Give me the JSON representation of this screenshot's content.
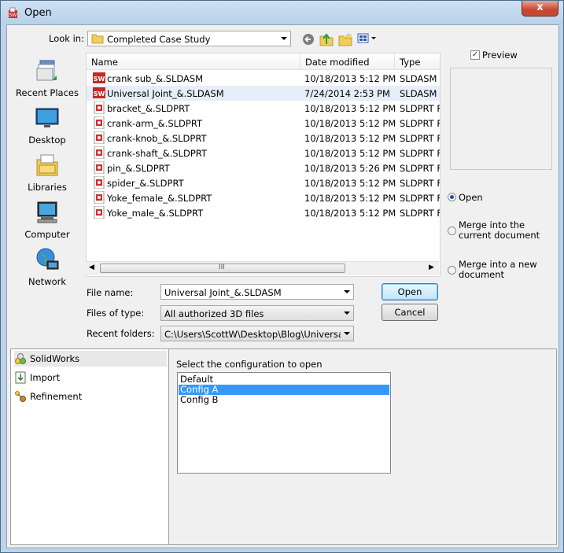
{
  "window": {
    "title": "Open",
    "close_label": "x"
  },
  "toolbar": {
    "look_in_label": "Look in:",
    "look_in_value": "Completed Case Study"
  },
  "places": [
    {
      "label": "Recent Places",
      "icon": "recent-places-icon"
    },
    {
      "label": "Desktop",
      "icon": "desktop-icon"
    },
    {
      "label": "Libraries",
      "icon": "libraries-icon"
    },
    {
      "label": "Computer",
      "icon": "computer-icon"
    },
    {
      "label": "Network",
      "icon": "network-icon"
    }
  ],
  "file_list": {
    "columns": [
      "Name",
      "Date modified",
      "Type"
    ],
    "rows": [
      {
        "name": "crank sub_&.SLDASM",
        "date": "10/18/2013 5:12 PM",
        "type": "SLDASM F",
        "kind": "assembly"
      },
      {
        "name": "Universal Joint_&.SLDASM",
        "date": "7/24/2014 2:53 PM",
        "type": "SLDASM F",
        "kind": "assembly"
      },
      {
        "name": "bracket_&.SLDPRT",
        "date": "10/18/2013 5:12 PM",
        "type": "SLDPRT Fi",
        "kind": "part"
      },
      {
        "name": "crank-arm_&.SLDPRT",
        "date": "10/18/2013 5:12 PM",
        "type": "SLDPRT Fi",
        "kind": "part"
      },
      {
        "name": "crank-knob_&.SLDPRT",
        "date": "10/18/2013 5:12 PM",
        "type": "SLDPRT Fi",
        "kind": "part"
      },
      {
        "name": "crank-shaft_&.SLDPRT",
        "date": "10/18/2013 5:12 PM",
        "type": "SLDPRT Fi",
        "kind": "part"
      },
      {
        "name": "pin_&.SLDPRT",
        "date": "10/18/2013 5:26 PM",
        "type": "SLDPRT Fi",
        "kind": "part"
      },
      {
        "name": "spider_&.SLDPRT",
        "date": "10/18/2013 5:12 PM",
        "type": "SLDPRT Fi",
        "kind": "part"
      },
      {
        "name": "Yoke_female_&.SLDPRT",
        "date": "10/18/2013 5:12 PM",
        "type": "SLDPRT Fi",
        "kind": "part"
      },
      {
        "name": "Yoke_male_&.SLDPRT",
        "date": "10/18/2013 5:12 PM",
        "type": "SLDPRT Fi",
        "kind": "part"
      }
    ],
    "selected_index": 1,
    "scroll_grip": "III"
  },
  "form": {
    "file_name_label": "File name:",
    "file_name_value": "Universal Joint_&.SLDASM",
    "files_of_type_label": "Files of type:",
    "files_of_type_value": "All authorized 3D files",
    "recent_folders_label": "Recent folders:",
    "recent_folders_value": "C:\\Users\\ScottW\\Desktop\\Blog\\Universal Joint"
  },
  "buttons": {
    "open": "Open",
    "cancel": "Cancel"
  },
  "preview": {
    "label": "Preview",
    "checked": true
  },
  "open_mode": {
    "options": [
      "Open",
      "Merge into the current document",
      "Merge into a new document"
    ],
    "selected": 0
  },
  "addins": {
    "items": [
      {
        "label": "SolidWorks",
        "icon": "solidworks-icon"
      },
      {
        "label": "Import",
        "icon": "import-icon"
      },
      {
        "label": "Refinement",
        "icon": "refinement-icon"
      }
    ],
    "selected": 0
  },
  "configuration": {
    "label": "Select the configuration to open",
    "items": [
      "Default",
      "Config A",
      "Config B"
    ],
    "selected": 1
  }
}
